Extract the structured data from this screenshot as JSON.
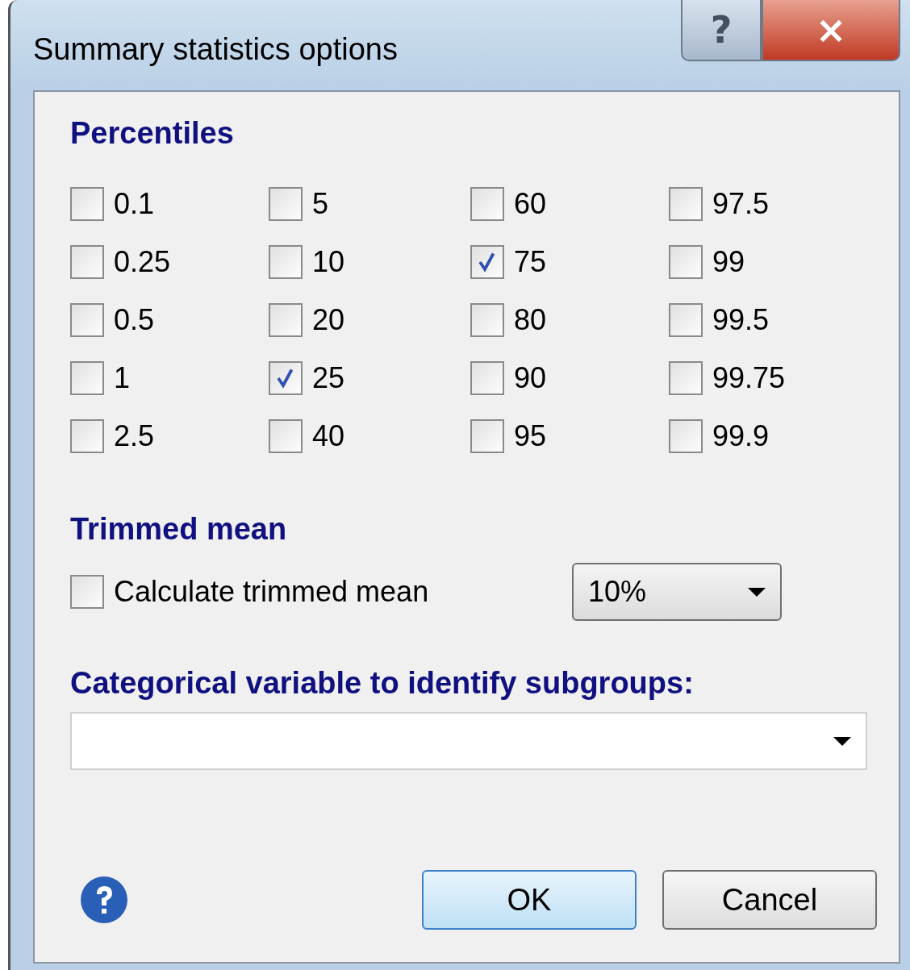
{
  "window": {
    "title": "Summary statistics options",
    "help_button": "?",
    "close_button": "×"
  },
  "percentiles": {
    "title": "Percentiles",
    "options": [
      {
        "label": "0.1",
        "checked": false
      },
      {
        "label": "0.25",
        "checked": false
      },
      {
        "label": "0.5",
        "checked": false
      },
      {
        "label": "1",
        "checked": false
      },
      {
        "label": "2.5",
        "checked": false
      },
      {
        "label": "5",
        "checked": false
      },
      {
        "label": "10",
        "checked": false
      },
      {
        "label": "20",
        "checked": false
      },
      {
        "label": "25",
        "checked": true
      },
      {
        "label": "40",
        "checked": false
      },
      {
        "label": "60",
        "checked": false
      },
      {
        "label": "75",
        "checked": true
      },
      {
        "label": "80",
        "checked": false
      },
      {
        "label": "90",
        "checked": false
      },
      {
        "label": "95",
        "checked": false
      },
      {
        "label": "97.5",
        "checked": false
      },
      {
        "label": "99",
        "checked": false
      },
      {
        "label": "99.5",
        "checked": false
      },
      {
        "label": "99.75",
        "checked": false
      },
      {
        "label": "99.9",
        "checked": false
      }
    ]
  },
  "trimmed_mean": {
    "title": "Trimmed mean",
    "checkbox": {
      "label": "Calculate trimmed mean",
      "checked": false
    },
    "dropdown": {
      "value": "10%"
    }
  },
  "subgroups": {
    "title": "Categorical variable to identify subgroups:"
  },
  "buttons": [
    {
      "label": "OK",
      "kind": "default"
    },
    {
      "label": "Cancel",
      "kind": "normal"
    }
  ]
}
